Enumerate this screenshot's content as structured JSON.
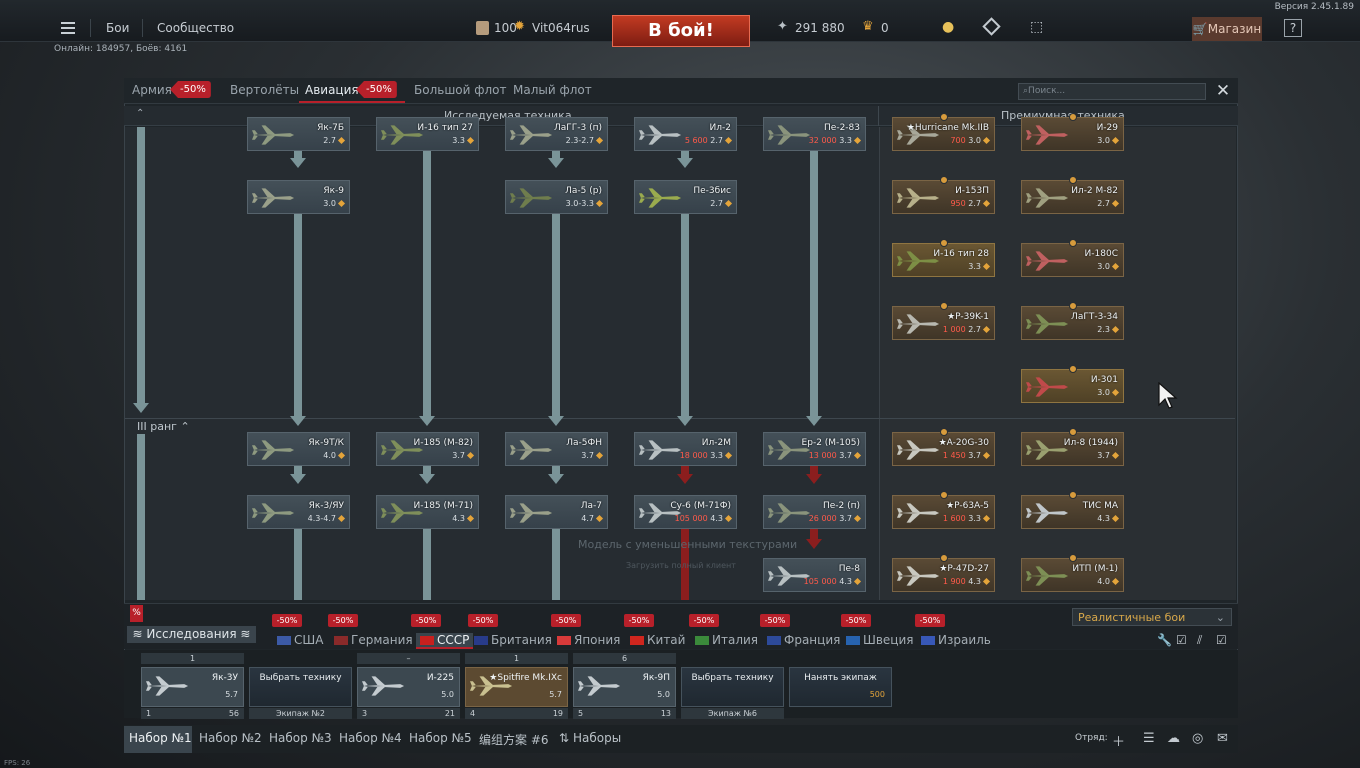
{
  "version": "Версия 2.45.1.89",
  "topbar": {
    "menu_icon": "hamburger-icon",
    "battles": "Бои",
    "community": "Сообщество",
    "level": "100",
    "username": "Vit064rus",
    "to_battle": "В бой!",
    "silver_lions": "291 880",
    "golden_eagles": "0",
    "shop": "Магазин",
    "help": "?"
  },
  "online": "Онлайн: 184957, Боёв: 4161",
  "branch_tabs": [
    {
      "label": "Армия",
      "discount": "-50%"
    },
    {
      "label": "Вертолёты"
    },
    {
      "label": "Авиация",
      "discount": "-50%",
      "active": true
    },
    {
      "label": "Большой флот"
    },
    {
      "label": "Малый флот"
    }
  ],
  "search_placeholder": "Поиск...",
  "columns": {
    "researched": "Исследуемая техника",
    "premium": "Премиумная техника"
  },
  "rank_label": "III ранг",
  "tree": {
    "row0": [
      {
        "name": "Як-7Б",
        "br": "2.7"
      },
      {
        "name": "И-16 тип 27",
        "br": "3.3"
      },
      {
        "name": "ЛаГГ-3 (п)",
        "br": "2.3-2.7"
      },
      {
        "name": "Ил-2",
        "br": "2.7",
        "price": "5 600"
      },
      {
        "name": "Пе-2-83",
        "br": "3.3",
        "price": "32 000"
      }
    ],
    "row1": [
      {
        "name": "Як-9",
        "br": "3.0"
      },
      {
        "name": "Ла-5 (р)",
        "br": "3.0-3.3"
      },
      {
        "name": "Пе-3бис",
        "br": "2.7"
      }
    ],
    "row3": [
      {
        "name": "Як-9Т/К",
        "br": "4.0"
      },
      {
        "name": "И-185 (М-82)",
        "br": "3.7"
      },
      {
        "name": "Ла-5ФН",
        "br": "3.7"
      },
      {
        "name": "Ил-2М",
        "br": "3.3",
        "price": "18 000"
      },
      {
        "name": "Ер-2 (М-105)",
        "br": "3.7",
        "price": "13 000"
      }
    ],
    "row4": [
      {
        "name": "Як-3/ЯУ",
        "br": "4.3-4.7"
      },
      {
        "name": "И-185 (М-71)",
        "br": "4.3"
      },
      {
        "name": "Ла-7",
        "br": "4.7"
      },
      {
        "name": "Су-6 (М-71Ф)",
        "br": "4.3",
        "price": "105 000"
      },
      {
        "name": "Пе-2 (п)",
        "br": "3.7",
        "price": "26 000"
      }
    ],
    "row5": [
      {
        "name": "Пе-8",
        "br": "4.3",
        "price": "105 000"
      }
    ]
  },
  "premium": [
    {
      "name": "★Hurricane Mk.IIB",
      "br": "3.0",
      "price": "700"
    },
    {
      "name": "И-29",
      "br": "3.0"
    },
    {
      "name": "И-153П",
      "br": "2.7",
      "price": "950"
    },
    {
      "name": "Ил-2 М-82",
      "br": "2.7"
    },
    {
      "name": "И-16 тип 28",
      "br": "3.3"
    },
    {
      "name": "И-180С",
      "br": "3.0"
    },
    {
      "name": "★P-39K-1",
      "br": "2.7",
      "price": "1 000"
    },
    {
      "name": "ЛаГТ-3-34",
      "br": "2.3"
    },
    {
      "name": "И-301",
      "br": "3.0"
    },
    {
      "name": "★A-20G-30",
      "br": "3.7",
      "price": "1 450"
    },
    {
      "name": "Ил-8 (1944)",
      "br": "3.7"
    },
    {
      "name": "★P-63A-5",
      "br": "3.3",
      "price": "1 600"
    },
    {
      "name": "ТИС МА",
      "br": "4.3"
    },
    {
      "name": "★P-47D-27",
      "br": "4.3",
      "price": "1 900"
    },
    {
      "name": "ИТП (М-1)",
      "br": "4.0"
    }
  ],
  "watermark": "Модель с уменьшенными текстурами",
  "watermark2": "Загрузить полный клиент",
  "nations": {
    "research_button": "Исследования",
    "research_flag": "%",
    "discount": "-50%",
    "tabs": [
      {
        "label": "США",
        "flag": "#3c5aa6"
      },
      {
        "label": "Германия",
        "flag": "#8a2a2a"
      },
      {
        "label": "СССР",
        "flag": "#c8201e",
        "active": true
      },
      {
        "label": "Британия",
        "flag": "#283b8a"
      },
      {
        "label": "Япония",
        "flag": "#d83a3a"
      },
      {
        "label": "Китай",
        "flag": "#d0261e"
      },
      {
        "label": "Италия",
        "flag": "#3b8a3b"
      },
      {
        "label": "Франция",
        "flag": "#2d4a9a"
      },
      {
        "label": "Швеция",
        "flag": "#2763b0"
      },
      {
        "label": "Израиль",
        "flag": "#3858b8"
      }
    ],
    "mode": "Реалистичные бои"
  },
  "slots": [
    {
      "top": "1",
      "name": "Як-3У",
      "br": "5.7",
      "left": "1",
      "right": "56"
    },
    {
      "crew": true,
      "text": "Выбрать технику",
      "bottom": "Экипаж №2"
    },
    {
      "top": "–",
      "name": "И-225",
      "br": "5.0",
      "left": "3",
      "right": "21"
    },
    {
      "top": "1",
      "name": "★Spitfire Mk.IXc",
      "br": "5.7",
      "left": "4",
      "right": "19",
      "prem": true
    },
    {
      "top": "6",
      "name": "Як-9П",
      "br": "5.0",
      "left": "5",
      "right": "13"
    },
    {
      "crew": true,
      "text": "Выбрать технику",
      "bottom": "Экипаж №6"
    },
    {
      "crew": true,
      "text": "Нанять экипаж",
      "cost": "500"
    }
  ],
  "presets": [
    "Набор №1",
    "Набор №2",
    "Набор №3",
    "Набор №4",
    "Набор №5",
    "编组方案 #6",
    "Наборы"
  ],
  "squad_label": "Отряд:",
  "fps": "FPS: 26"
}
